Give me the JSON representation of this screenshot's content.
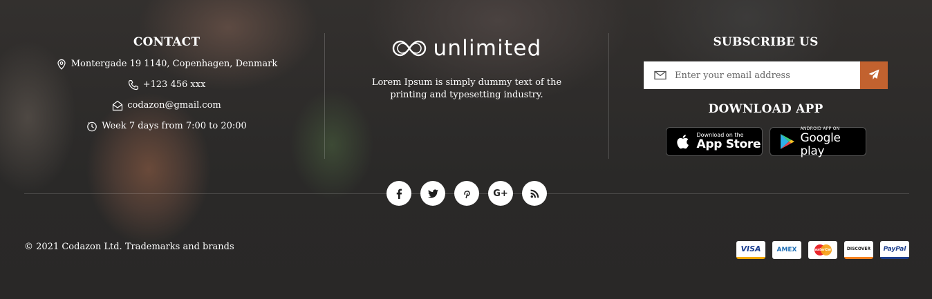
{
  "contact": {
    "heading": "CONTACT",
    "address": "Montergade 19 1140, Copenhagen, Denmark",
    "phone": "+123 456 xxx",
    "email": "codazon@gmail.com",
    "hours": "Week 7 days from 7:00 to 20:00"
  },
  "about": {
    "logo_text": "unlimited",
    "description": "Lorem Ipsum is simply dummy text of the printing and typesetting industry."
  },
  "subscribe": {
    "heading": "SUBSCRIBE US",
    "placeholder": "Enter your email address",
    "accent_color": "#c2622f"
  },
  "download": {
    "heading": "DOWNLOAD APP",
    "app_store": {
      "small": "Download on the",
      "big": "App Store"
    },
    "google_play": {
      "small": "ANDROID APP ON",
      "big": "Google play"
    }
  },
  "social": [
    {
      "name": "facebook",
      "glyph": "f"
    },
    {
      "name": "twitter",
      "glyph": "twitter-icon"
    },
    {
      "name": "pinterest",
      "glyph": "pinterest-icon"
    },
    {
      "name": "google-plus",
      "glyph": "G+"
    },
    {
      "name": "rss",
      "glyph": "rss-icon"
    }
  ],
  "footer": {
    "copyright": "© 2021 Codazon Ltd. Trademarks and brands",
    "payments": {
      "visa": "VISA",
      "amex": "AMEX",
      "mastercard": "MasterCard",
      "discover": "DISCOVER",
      "paypal": "PayPal"
    }
  }
}
